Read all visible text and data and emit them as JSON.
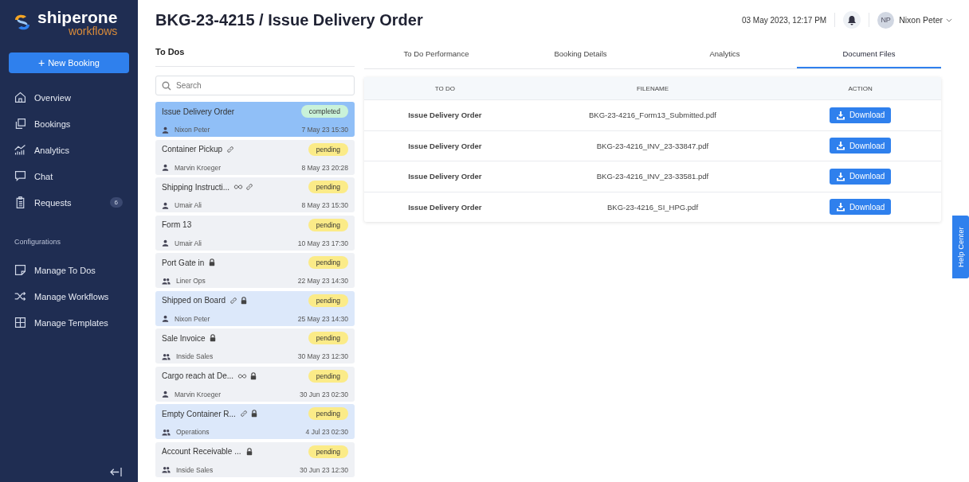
{
  "brand": {
    "name": "shiperone",
    "sub": "workflows"
  },
  "new_booking": {
    "icon": "+",
    "label": "New Booking"
  },
  "nav": [
    {
      "label": "Overview"
    },
    {
      "label": "Bookings"
    },
    {
      "label": "Analytics"
    },
    {
      "label": "Chat"
    },
    {
      "label": "Requests",
      "badge": "6"
    }
  ],
  "config_heading": "Configurations",
  "config_nav": [
    {
      "label": "Manage To Dos"
    },
    {
      "label": "Manage Workflows"
    },
    {
      "label": "Manage Templates"
    }
  ],
  "page_title": "BKG-23-4215 / Issue Delivery Order",
  "datetime": "03 May 2023, 12:17 PM",
  "user": {
    "initials": "NP",
    "name": "Nixon Peter"
  },
  "todos_heading": "To Dos",
  "search": {
    "placeholder": "Search"
  },
  "todos": [
    {
      "title": "Issue Delivery Order",
      "recurring": false,
      "linked": false,
      "locked": false,
      "assignee": "Nixon Peter",
      "team": false,
      "date": "7 May 23 15:30",
      "status": "completed",
      "color": "#c9f2d9",
      "selected": true,
      "highlighted": false
    },
    {
      "title": "Container Pickup",
      "recurring": false,
      "linked": true,
      "locked": false,
      "assignee": "Marvin Kroeger",
      "team": false,
      "date": "8 May 23 20:28",
      "status": "pending",
      "color": "#fbeb88",
      "selected": false,
      "highlighted": false
    },
    {
      "title": "Shipping Instructi...",
      "recurring": true,
      "linked": true,
      "locked": false,
      "assignee": "Umair Ali",
      "team": false,
      "date": "8 May 23 15:30",
      "status": "pending",
      "color": "#fbeb88",
      "selected": false,
      "highlighted": false
    },
    {
      "title": "Form 13",
      "recurring": false,
      "linked": false,
      "locked": false,
      "assignee": "Umair Ali",
      "team": false,
      "date": "10 May 23 17:30",
      "status": "pending",
      "color": "#fbeb88",
      "selected": false,
      "highlighted": false
    },
    {
      "title": "Port Gate in",
      "recurring": false,
      "linked": false,
      "locked": true,
      "assignee": "Liner Ops",
      "team": true,
      "date": "22 May 23 14:30",
      "status": "pending",
      "color": "#fbeb88",
      "selected": false,
      "highlighted": false
    },
    {
      "title": "Shipped on Board",
      "recurring": false,
      "linked": true,
      "locked": true,
      "assignee": "Nixon Peter",
      "team": false,
      "date": "25 May 23 14:30",
      "status": "pending",
      "color": "#fbeb88",
      "selected": false,
      "highlighted": true
    },
    {
      "title": "Sale Invoice",
      "recurring": false,
      "linked": false,
      "locked": true,
      "assignee": "Inside Sales",
      "team": true,
      "date": "30 May 23 12:30",
      "status": "pending",
      "color": "#fbeb88",
      "selected": false,
      "highlighted": false
    },
    {
      "title": "Cargo reach at De...",
      "recurring": true,
      "linked": false,
      "locked": true,
      "assignee": "Marvin Kroeger",
      "team": false,
      "date": "30 Jun 23 02:30",
      "status": "pending",
      "color": "#fbeb88",
      "selected": false,
      "highlighted": false
    },
    {
      "title": "Empty Container R...",
      "recurring": false,
      "linked": true,
      "locked": true,
      "assignee": "Operations",
      "team": true,
      "date": "4 Jul 23 02:30",
      "status": "pending",
      "color": "#fbeb88",
      "selected": false,
      "highlighted": true
    },
    {
      "title": "Account Receivable ...",
      "recurring": false,
      "linked": false,
      "locked": true,
      "assignee": "Inside Sales",
      "team": true,
      "date": "30 Jun 23 12:30",
      "status": "pending",
      "color": "#fbeb88",
      "selected": false,
      "highlighted": false
    }
  ],
  "tabs": [
    {
      "label": "To Do Performance",
      "selected": false
    },
    {
      "label": "Booking Details",
      "selected": false
    },
    {
      "label": "Analytics",
      "selected": false
    },
    {
      "label": "Document Files",
      "selected": true
    }
  ],
  "table": {
    "columns": [
      "TO DO",
      "FILENAME",
      "ACTION"
    ],
    "rows": [
      {
        "todo": "Issue Delivery Order",
        "filename": "BKG-23-4216_Form13_Submitted.pdf",
        "action": "Download"
      },
      {
        "todo": "Issue Delivery Order",
        "filename": "BKG-23-4216_INV_23-33847.pdf",
        "action": "Download"
      },
      {
        "todo": "Issue Delivery Order",
        "filename": "BKG-23-4216_INV_23-33581.pdf",
        "action": "Download"
      },
      {
        "todo": "Issue Delivery Order",
        "filename": "BKG-23-4216_SI_HPG.pdf",
        "action": "Download"
      }
    ]
  },
  "help_center": "Help Center"
}
